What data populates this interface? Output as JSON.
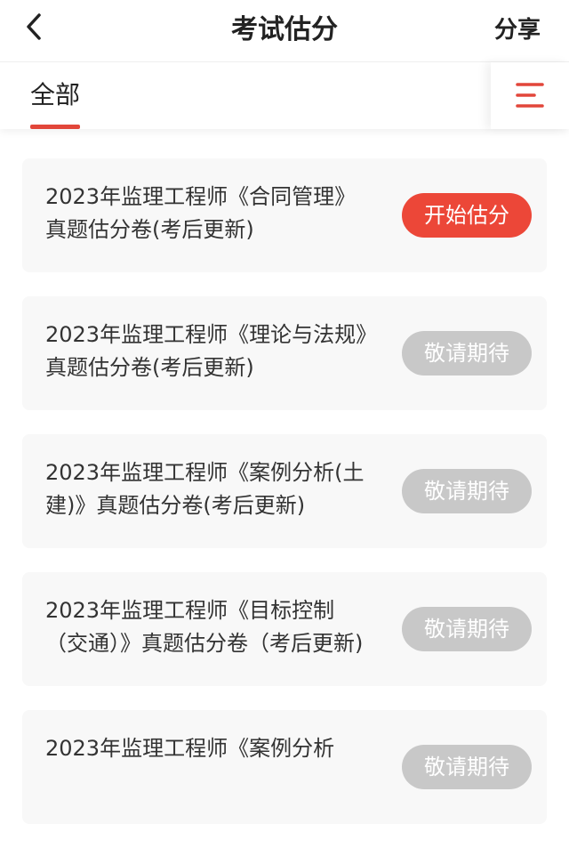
{
  "header": {
    "title": "考试估分",
    "share_label": "分享"
  },
  "tabs": {
    "active_label": "全部"
  },
  "colors": {
    "accent": "#e2463a",
    "button_active": "#ec4738",
    "button_disabled": "#c8c8c8",
    "card_bg": "#f8f8f8"
  },
  "icons": {
    "back": "chevron-left-icon",
    "menu": "filter-menu-icon"
  },
  "papers": [
    {
      "title": "2023年监理工程师《合同管理》真题估分卷(考后更新)",
      "button": "开始估分",
      "active": true
    },
    {
      "title": "2023年监理工程师《理论与法规》真题估分卷(考后更新)",
      "button": "敬请期待",
      "active": false
    },
    {
      "title": "2023年监理工程师《案例分析(土建)》真题估分卷(考后更新)",
      "button": "敬请期待",
      "active": false
    },
    {
      "title": "2023年监理工程师《目标控制（交通）》真题估分卷（考后更新)",
      "button": "敬请期待",
      "active": false
    },
    {
      "title": "2023年监理工程师《案例分析",
      "button": "敬请期待",
      "active": false
    }
  ]
}
